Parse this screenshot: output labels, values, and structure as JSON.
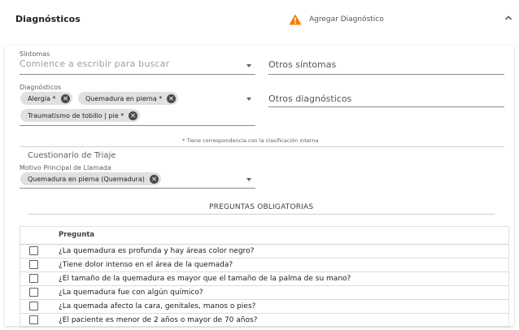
{
  "header": {
    "title": "Diagnósticos",
    "add_label": "Agregar Diagnóstico",
    "warning_color": "#f57c00"
  },
  "symptoms": {
    "label": "Síntomas",
    "placeholder": "Comience a escribir para buscar",
    "other_placeholder": "Otros síntomas"
  },
  "diagnoses": {
    "label": "Diagnósticos",
    "chips": [
      "Alergia *",
      "Quemadura en pierna *",
      "Traumatismo de tobillo | pie *"
    ],
    "other_placeholder": "Otros diagnósticos"
  },
  "note": "* Tiene correspondencia con la clasificación interna",
  "triage": {
    "title": "Cuestionario de Triaje",
    "motive_label": "Motivo Principal de Llamada",
    "motive_chip": "Quemadura en pierna (Quemadura)"
  },
  "questions": {
    "section_title": "PREGUNTAS OBLIGATORIAS",
    "column_header": "Pregunta",
    "rows": [
      "¿La quemadura es profunda y hay áreas color negro?",
      "¿Tiene dolor intenso en el área de la quemada?",
      "¿El tamaño de la quemadura es mayor que el tamaño de la palma de su mano?",
      "¿La quemadura fue con algún químico?",
      "¿La quemada afecto la cara, genitales, manos o pies?",
      "¿El paciente es menor de 2 años o mayor de 70 años?"
    ]
  }
}
